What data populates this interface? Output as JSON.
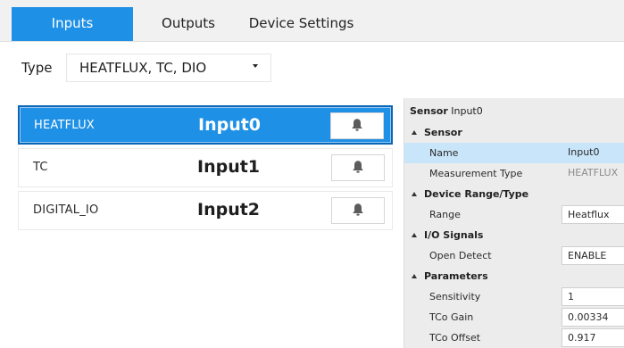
{
  "tabs": [
    {
      "label": "Inputs"
    },
    {
      "label": "Outputs"
    },
    {
      "label": "Device Settings"
    }
  ],
  "type_filter": {
    "label": "Type",
    "value": "HEATFLUX, TC, DIO"
  },
  "channels": [
    {
      "type": "HEATFLUX",
      "name": "Input0",
      "selected": true
    },
    {
      "type": "TC",
      "name": "Input1",
      "selected": false
    },
    {
      "type": "DIGITAL_IO",
      "name": "Input2",
      "selected": false
    }
  ],
  "properties": {
    "header_label": "Sensor",
    "header_value": "Input0",
    "categories": [
      {
        "name": "Sensor",
        "items": [
          {
            "name": "Name",
            "value": "Input0"
          },
          {
            "name": "Measurement Type",
            "value": "HEATFLUX"
          }
        ]
      },
      {
        "name": "Device Range/Type",
        "items": [
          {
            "name": "Range",
            "value": "Heatflux"
          }
        ]
      },
      {
        "name": "I/O Signals",
        "items": [
          {
            "name": "Open Detect",
            "value": "ENABLE"
          }
        ]
      },
      {
        "name": "Parameters",
        "items": [
          {
            "name": "Sensitivity",
            "value": "1"
          },
          {
            "name": "TCo Gain",
            "value": "0.00334"
          },
          {
            "name": "TCo Offset",
            "value": "0.917"
          }
        ]
      }
    ]
  },
  "colors": {
    "accent": "#1e90e6",
    "selection_border": "#0a66b8",
    "property_highlight": "#c9e5fa",
    "panel_bg": "#ececec"
  },
  "icons": {
    "alarm": "bell-icon",
    "dropdown": "chevron-down-icon",
    "category": "collapse-triangle-icon"
  }
}
